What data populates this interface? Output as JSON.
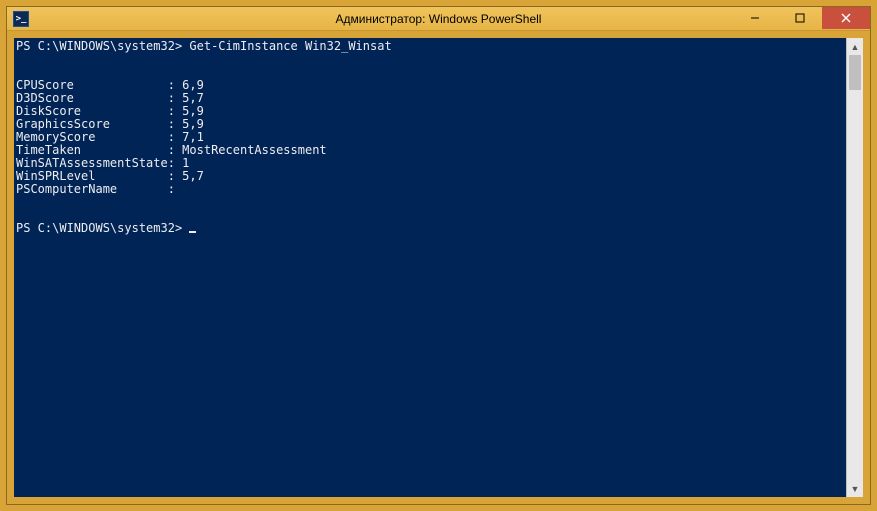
{
  "window": {
    "title": "Администратор: Windows PowerShell",
    "icon_glyph": ">_"
  },
  "terminal": {
    "prompt1": "PS C:\\WINDOWS\\system32>",
    "command": "Get-CimInstance Win32_Winsat",
    "output_rows": [
      {
        "key": "CPUScore",
        "value": "6,9"
      },
      {
        "key": "D3DScore",
        "value": "5,7"
      },
      {
        "key": "DiskScore",
        "value": "5,9"
      },
      {
        "key": "GraphicsScore",
        "value": "5,9"
      },
      {
        "key": "MemoryScore",
        "value": "7,1"
      },
      {
        "key": "TimeTaken",
        "value": "MostRecentAssessment"
      },
      {
        "key": "WinSATAssessmentState",
        "value": "1"
      },
      {
        "key": "WinSPRLevel",
        "value": "5,7"
      },
      {
        "key": "PSComputerName",
        "value": ""
      }
    ],
    "prompt2": "PS C:\\WINDOWS\\system32>"
  }
}
